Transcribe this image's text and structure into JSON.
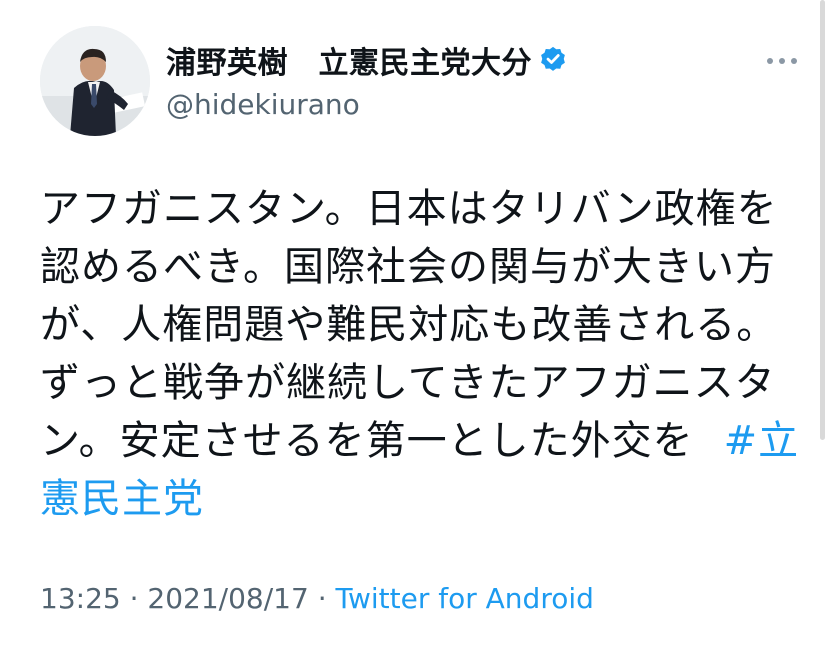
{
  "user": {
    "display_name": "浦野英樹　立憲民主党大分",
    "handle": "@hidekiurano"
  },
  "tweet": {
    "text": "アフガニスタン。日本はタリバン政権を認めるべき。国際社会の関与が大きい方が、人権問題や難民対応も改善される。ずっと戦争が継続してきたアフガニスタン。安定させるを第一とした外交を",
    "hashtag": "#立憲民主党"
  },
  "meta": {
    "time": "13:25",
    "date": "2021/08/17",
    "separator": " · ",
    "source": "Twitter for Android"
  },
  "icons": {
    "more": "more-dots-icon",
    "verified": "verified-badge-icon"
  },
  "colors": {
    "link": "#1d9bf0",
    "secondary": "#536471",
    "verified": "#1d9bf0"
  }
}
